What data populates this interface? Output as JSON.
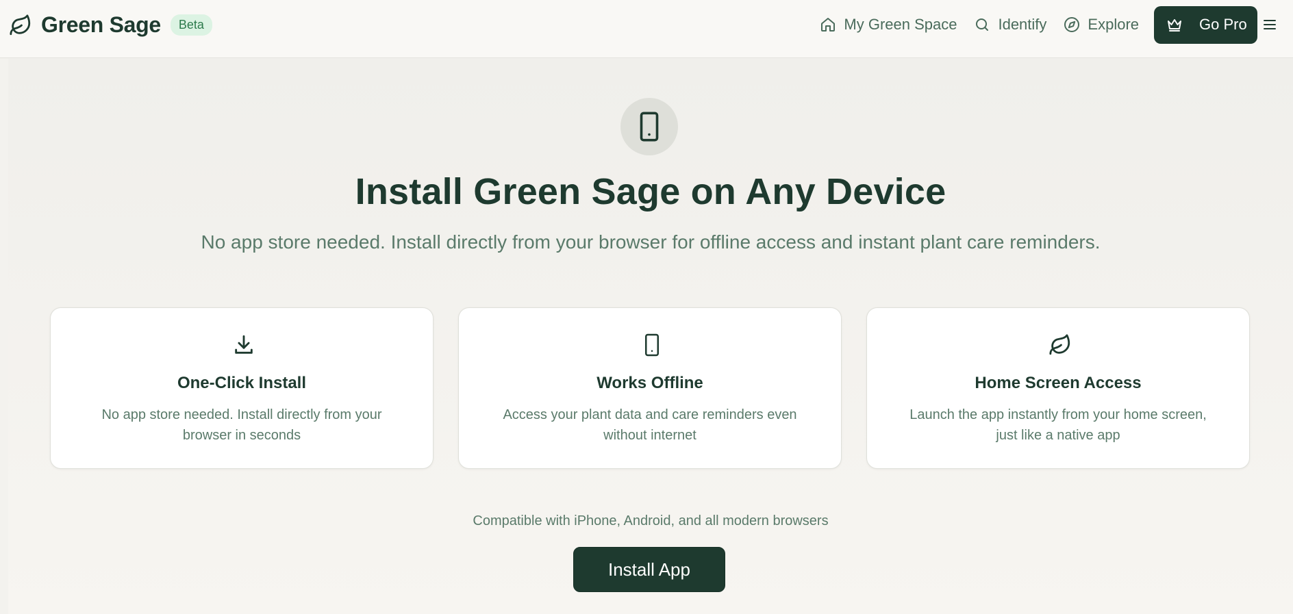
{
  "header": {
    "brand_name": "Green Sage",
    "beta_label": "Beta",
    "nav": [
      {
        "label": "My Green Space",
        "icon": "home-icon"
      },
      {
        "label": "Identify",
        "icon": "search-icon"
      },
      {
        "label": "Explore",
        "icon": "compass-icon"
      }
    ],
    "go_pro_label": "Go Pro",
    "go_pro_icon": "crown-icon",
    "menu_icon": "hamburger-menu-icon"
  },
  "hero": {
    "icon": "smartphone-icon",
    "title": "Install Green Sage on Any Device",
    "subtitle": "No app store needed. Install directly from your browser for offline access and instant plant care reminders."
  },
  "features": [
    {
      "icon": "download-icon",
      "title": "One-Click Install",
      "description": "No app store needed. Install directly from your browser in seconds"
    },
    {
      "icon": "smartphone-icon",
      "title": "Works Offline",
      "description": "Access your plant data and care reminders even without internet"
    },
    {
      "icon": "leaf-icon",
      "title": "Home Screen Access",
      "description": "Launch the app instantly from your home screen, just like a native app"
    }
  ],
  "compatibility_text": "Compatible with iPhone, Android, and all modern browsers",
  "install_button_label": "Install App",
  "colors": {
    "primary": "#1e3a2f",
    "muted_text": "#5a7a6a",
    "badge_bg": "#dcf3e3",
    "badge_text": "#2c7a4b",
    "page_bg": "#f3f2ee"
  }
}
